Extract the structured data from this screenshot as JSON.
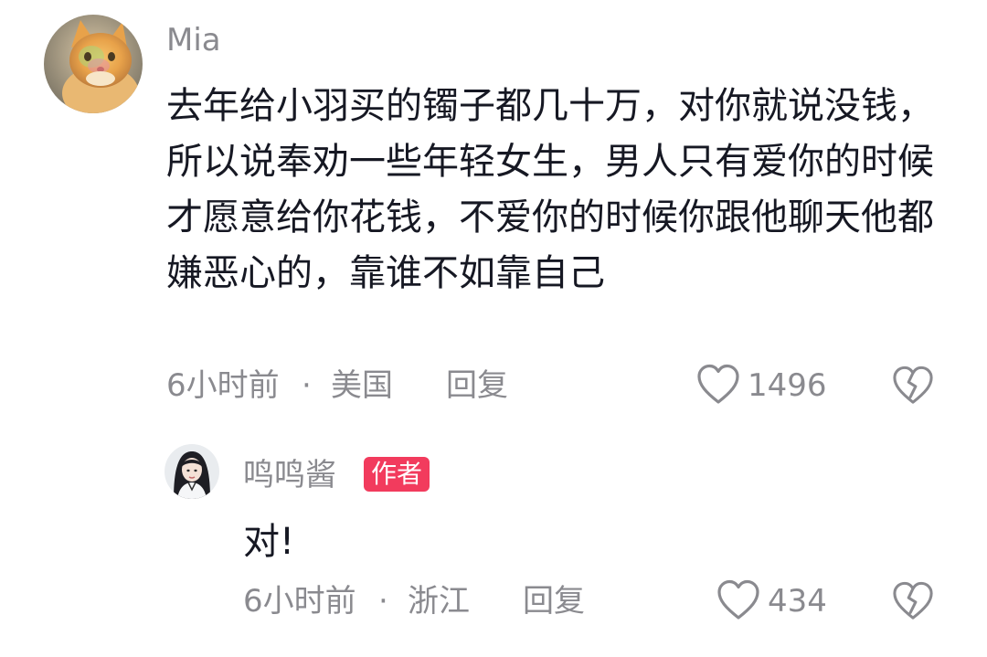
{
  "comments": [
    {
      "username": "Mia",
      "text": "去年给小羽买的镯子都几十万，对你就说没钱，所以说奉劝一些年轻女生，男人只有爱你的时候才愿意给你花钱，不爱你的时候你跟他聊天他都嫌恶心的，靠谁不如靠自己",
      "time": "6小时前",
      "location": "美国",
      "reply_label": "回复",
      "like_count": "1496",
      "avatar_icon": "cat-avatar"
    }
  ],
  "replies": [
    {
      "username": "鸣鸣酱",
      "badge": "作者",
      "text": "对!",
      "time": "6小时前",
      "location": "浙江",
      "reply_label": "回复",
      "like_count": "434",
      "avatar_icon": "girl-avatar"
    }
  ],
  "icons": {
    "like": "heart-outline-icon",
    "dislike": "broken-heart-icon"
  },
  "colors": {
    "badge_bg": "#f23b5d",
    "meta_text": "#8a8a8f",
    "body_text": "#161823"
  },
  "meta_separator": "·"
}
